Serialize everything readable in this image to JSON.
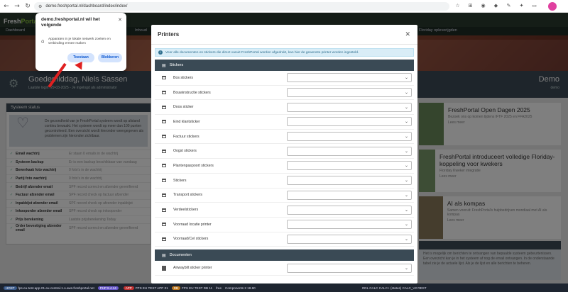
{
  "browser": {
    "url": "demo.freshportal.nl/dashboard/index/index/"
  },
  "app": {
    "brand_prefix": "Fresh",
    "brand_suffix": "Portal",
    "menu": [
      "Dashboard",
      "Inhoud",
      "Floriday opleverijgden"
    ]
  },
  "page": {
    "greeting": "Goedemiddag, Niels Sassen",
    "greeting_sub": "Laatste login: 29-03-2025 - Je ingelogd als administrator",
    "company": "Demo",
    "company_sub": "demo"
  },
  "status": {
    "title": "Systeem status",
    "intro": "De gezondheid van je FreshPortal systeem wordt op afstand continu bewaakt. Het systeem wordt op meer dan 100 punten gecontroleerd. Een overzicht wordt hieronder weergegeven als problemen zijn hieronder zichtbaar.",
    "rows": [
      {
        "name": "Email wachtrij",
        "desc": "Er staan 0 emails in de wachtrij"
      },
      {
        "name": "Systeem backup",
        "desc": "Er is een backup beschikbaar van vandaag"
      },
      {
        "name": "Bewerkaak foto wachtrij",
        "desc": "0 foto's in de wachtrij"
      },
      {
        "name": "Partij foto wachtrij",
        "desc": "0 foto's in de wachtrij"
      },
      {
        "name": "Bedrijf afzender email",
        "desc": "SPF record correct en afzender geverifieerd"
      },
      {
        "name": "Factuur afzender email",
        "desc": "SPF record check op factuur afzender"
      },
      {
        "name": "Inpakbijst afzender email",
        "desc": "SPF record check op afzender inpakbijst"
      },
      {
        "name": "Inkooporder afzender email",
        "desc": "SPF record check op inkooporder"
      },
      {
        "name": "Prijs berekening",
        "desc": "Laatste prijsberekening Today"
      },
      {
        "name": "Order bevestiging afzender email",
        "desc": "SPF record correct en afzender geverifieerd"
      }
    ]
  },
  "news": [
    {
      "title": "FreshPortal Open Dagen 2025",
      "text": "Bezoek ons op komen tijdens IFTF 2025 en FFA2025",
      "more": "Lees meer"
    },
    {
      "title": "FreshPortal introduceert volledige Floriday-koppeling voor kwekers",
      "text": "Floriday Kweker integratie",
      "more": "Lees meer"
    },
    {
      "title": "AI als kompas",
      "text": "Samen vooruit: FreshPortal's hulpbedrijven mondiaal met AI als kompas",
      "more": "Lees meer"
    }
  ],
  "bottom_card": {
    "text": "Het is mogelijk om berichten te ontvangen van bepaalde systeem gebeurtenissen. Een overzicht kan je in het systeem af nog de email ontvangen. In de onderstaande tabel zie je de actuele lijst. Als je de lijst en alle berichten te beheren."
  },
  "permission": {
    "title": "demo.freshportal.nl wil het volgende",
    "text": "Apparaten in je lokale netwerk zoeken en verbinding ermee maken",
    "allow": "Toestaan",
    "block": "Blokkeren"
  },
  "modal": {
    "title": "Printers",
    "info": "Voor alle documenten en stickers die direct vanuit FreshPortal worden afgedrukt, kan hier de gewenste printer worden ingesteld.",
    "section_stickers": "Stickers",
    "section_documents": "Documenten",
    "stickers": [
      "Bos stickers",
      "Bouwinstructie stickers",
      "Doos sticker",
      "Eind klantsticker",
      "Factuur stickers",
      "Oogst stickers",
      "Plantenpaspoort stickers",
      "Stickers",
      "Transport stickers",
      "Verdeelstickers",
      "Voorraad locatie printer",
      "Voorraad/Cel stickers"
    ],
    "documents": [
      "Airwaybill sticker printer"
    ]
  },
  "taskbar": {
    "items": [
      "HOST",
      "fps-eu-test-app-01.eu-central-1.o.aws.freshportal.net",
      "PHP 8.4.14",
      "APP",
      "FPS EU TEST APP 01",
      "DB",
      "FPS EU TEST DB 11",
      "free",
      "Components 2 18.60",
      "ODL CALC CALC+ (status) CALC_V2 REST"
    ]
  }
}
